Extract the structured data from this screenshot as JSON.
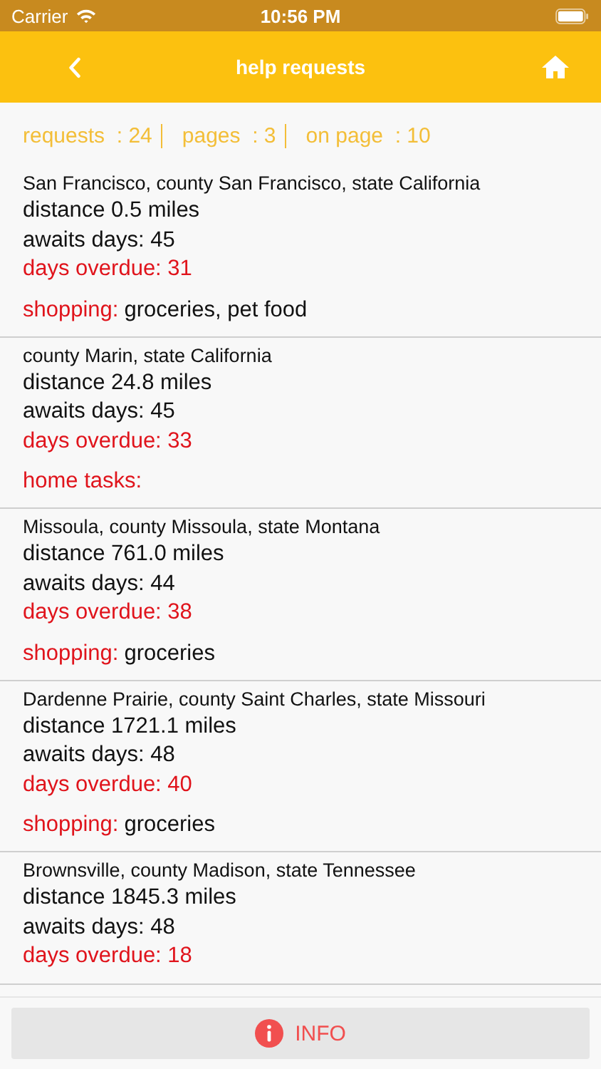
{
  "status_bar": {
    "carrier": "Carrier",
    "time": "10:56 PM"
  },
  "nav": {
    "title": "help requests"
  },
  "summary": [
    "requests  : 24",
    "pages  : 3",
    "on page  : 10"
  ],
  "requests": [
    {
      "location": "San Francisco, county San Francisco, state California",
      "distance": "distance 0.5 miles",
      "awaits": "awaits days: 45",
      "overdue": "days overdue: 31",
      "category": "shopping:",
      "items": "groceries, pet food"
    },
    {
      "location": "county Marin, state California",
      "distance": "distance 24.8 miles",
      "awaits": "awaits days: 45",
      "overdue": "days overdue: 33",
      "category": "home tasks:"
    },
    {
      "location": "Missoula, county Missoula, state Montana",
      "distance": "distance 761.0 miles",
      "awaits": "awaits days: 44",
      "overdue": "days overdue: 38",
      "category": "shopping:",
      "items": "groceries"
    },
    {
      "location": "Dardenne Prairie, county Saint Charles, state Missouri",
      "distance": "distance 1721.1 miles",
      "awaits": "awaits days: 48",
      "overdue": "days overdue: 40",
      "category": "shopping:",
      "items": "groceries"
    },
    {
      "location": "Brownsville, county Madison, state Tennessee",
      "distance": "distance 1845.3 miles",
      "awaits": "awaits days: 48",
      "overdue": "days overdue: 18"
    }
  ],
  "footer": {
    "button": "INFO"
  }
}
